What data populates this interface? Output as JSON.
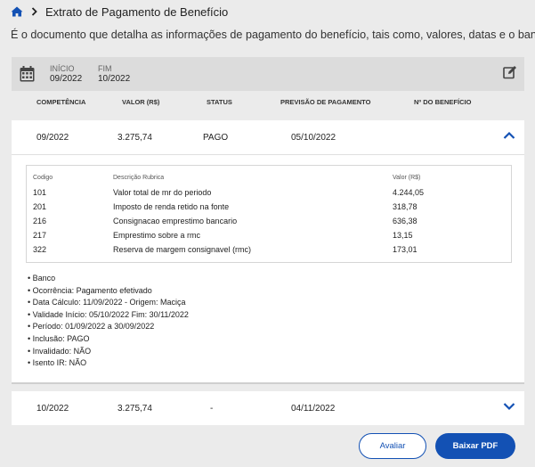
{
  "header": {
    "title": "Extrato de Pagamento de Benefício",
    "subtitle": "É o documento que detalha as informações de pagamento do benefício, tais como, valores, datas e o banco."
  },
  "period": {
    "start_label": "INÍCIO",
    "start_value": "09/2022",
    "end_label": "FIM",
    "end_value": "10/2022"
  },
  "columns": {
    "competencia": "COMPETÊNCIA",
    "valor": "VALOR (R$)",
    "status": "STATUS",
    "previsao": "PREVISÃO DE PAGAMENTO",
    "beneficio": "Nº DO BENEFÍCIO"
  },
  "rows": [
    {
      "competencia": "09/2022",
      "valor": "3.275,74",
      "status": "PAGO",
      "previsao": "05/10/2022",
      "expanded": true
    },
    {
      "competencia": "10/2022",
      "valor": "3.275,74",
      "status": "-",
      "previsao": "04/11/2022",
      "expanded": false
    }
  ],
  "detail": {
    "rubrica_headers": {
      "codigo": "Codigo",
      "descricao": "Descrição Rubrica",
      "valor": "Valor (R$)"
    },
    "rubricas": [
      {
        "codigo": "101",
        "descricao": "Valor total de mr do periodo",
        "valor": "4.244,05"
      },
      {
        "codigo": "201",
        "descricao": "Imposto de renda retido na fonte",
        "valor": "318,78"
      },
      {
        "codigo": "216",
        "descricao": "Consignacao emprestimo bancario",
        "valor": "636,38"
      },
      {
        "codigo": "217",
        "descricao": "Emprestimo sobre a rmc",
        "valor": "13,15"
      },
      {
        "codigo": "322",
        "descricao": "Reserva de margem consignavel (rmc)",
        "valor": "173,01"
      }
    ],
    "info": [
      "• Banco",
      "• Ocorrência: Pagamento efetivado",
      "• Data Cálculo: 11/09/2022 - Origem: Maciça",
      "• Validade Início: 05/10/2022 Fim: 30/11/2022",
      "• Período: 01/09/2022 a 30/09/2022",
      "• Inclusão: PAGO",
      "• Invalidado: NÃO",
      "• Isento IR: NÃO"
    ]
  },
  "buttons": {
    "avaliar": "Avaliar",
    "baixar_pdf": "Baixar PDF"
  },
  "colors": {
    "primary": "#1351b4",
    "background": "#ebebeb",
    "period_bar": "#dcdcdc"
  },
  "icons": [
    "home-icon",
    "chevron-right-icon",
    "calendar-icon",
    "edit-icon",
    "chevron-up-icon",
    "chevron-down-icon"
  ]
}
